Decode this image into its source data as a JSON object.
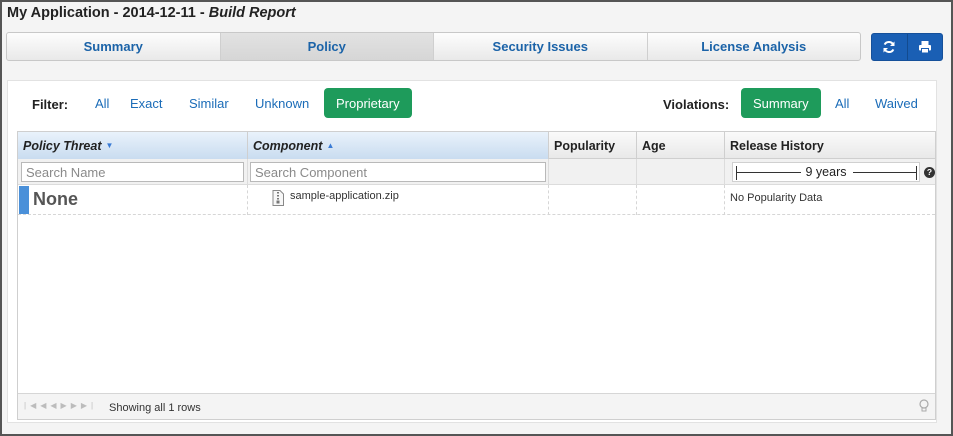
{
  "header": {
    "app_name": "My Application",
    "separator": " - ",
    "date": "2014-12-11",
    "separator2": " - ",
    "report": "Build Report"
  },
  "tabs": [
    {
      "label": "Summary"
    },
    {
      "label": "Policy",
      "active": true
    },
    {
      "label": "Security Issues"
    },
    {
      "label": "License Analysis"
    }
  ],
  "toolbar": {
    "refresh_icon": "refresh-icon",
    "print_icon": "print-icon",
    "accent": "#1a5fb4"
  },
  "filter": {
    "label": "Filter:",
    "options": [
      "All",
      "Exact",
      "Similar",
      "Unknown",
      "Proprietary"
    ],
    "selected": "Proprietary"
  },
  "violations": {
    "label": "Violations:",
    "options": [
      "Summary",
      "All",
      "Waived"
    ],
    "selected": "Summary"
  },
  "table": {
    "columns": [
      "Policy Threat",
      "Component",
      "Popularity",
      "Age",
      "Release History"
    ],
    "sort_icons": {
      "policy_threat": "sort-desc-icon",
      "component": "sort-asc-icon"
    },
    "search_name_placeholder": "Search Name",
    "search_component_placeholder": "Search Component",
    "release_range": "9 years",
    "rows": [
      {
        "threat": "None",
        "threat_color": "#4a90d9",
        "component": "sample-application.zip",
        "popularity": "",
        "age": "",
        "release_history": "No Popularity Data"
      }
    ],
    "footer_text": "Showing all 1 rows"
  },
  "colors": {
    "selected_pill": "#1e9b5b",
    "link": "#1b6cb8"
  }
}
